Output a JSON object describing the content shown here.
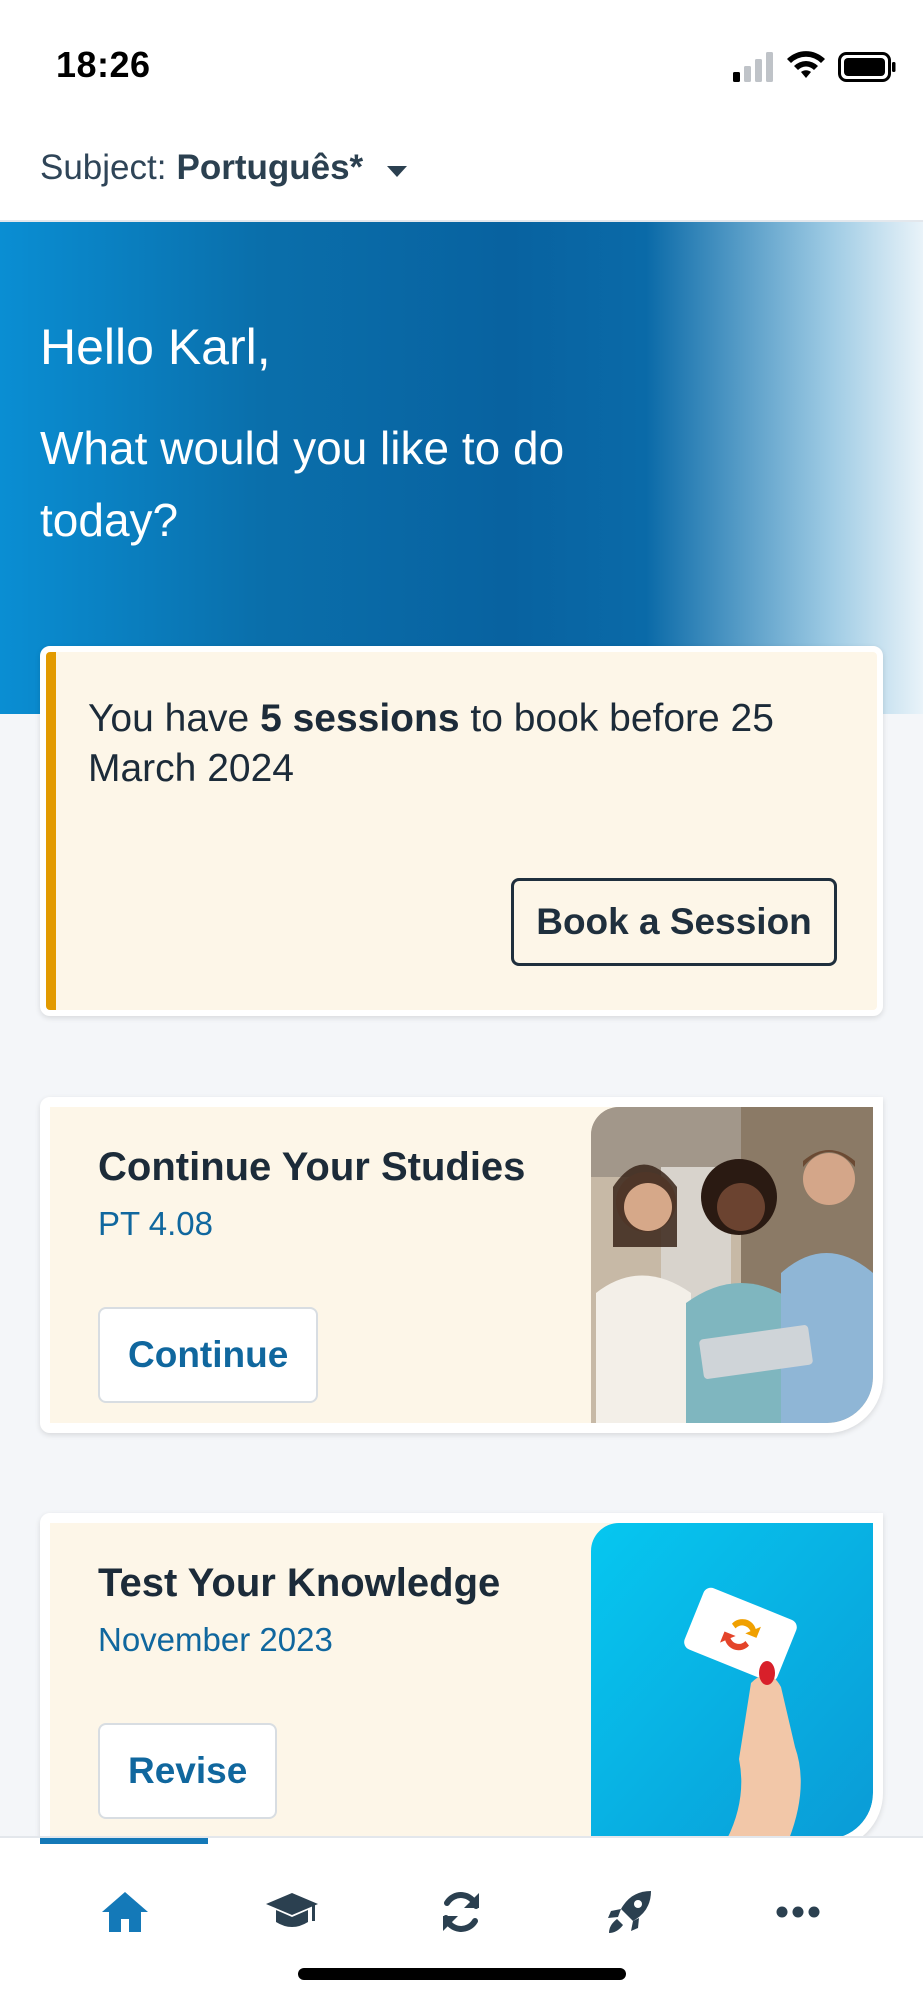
{
  "status": {
    "time": "18:26"
  },
  "subject": {
    "label": "Subject:",
    "value": "Português*"
  },
  "hero": {
    "greeting": "Hello Karl,",
    "question": "What would you like to do today?"
  },
  "notice": {
    "prefix": "You have ",
    "highlight": "5 sessions",
    "suffix": " to book before 25 March 2024",
    "button": "Book a Session"
  },
  "cards": [
    {
      "title": "Continue Your Studies",
      "subtitle": "PT 4.08",
      "button": "Continue"
    },
    {
      "title": "Test Your Knowledge",
      "subtitle": "November 2023",
      "button": "Revise"
    }
  ],
  "tabs": [
    {
      "icon": "home-icon"
    },
    {
      "icon": "graduation-cap-icon"
    },
    {
      "icon": "refresh-icon"
    },
    {
      "icon": "rocket-icon"
    },
    {
      "icon": "more-icon"
    }
  ],
  "colors": {
    "brand": "#0a6fab",
    "accent": "#e29a00",
    "link": "#10679e"
  }
}
